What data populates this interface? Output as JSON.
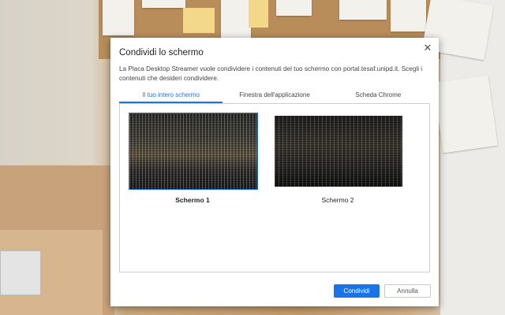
{
  "dialog": {
    "title": "Condividi lo schermo",
    "description": "La Placa Desktop Streamer vuole condividere i contenuti del tuo schermo con portal.tesaf.unipd.it. Scegli i contenuti che desideri condividere.",
    "close_icon": "close-icon"
  },
  "tabs": [
    {
      "label": "Il tuo intero schermo",
      "active": true
    },
    {
      "label": "Finestra dell'applicazione",
      "active": false
    },
    {
      "label": "Scheda Chrome",
      "active": false
    }
  ],
  "screens": [
    {
      "label": "Schermo 1",
      "selected": true
    },
    {
      "label": "Schermo 2",
      "selected": false
    }
  ],
  "buttons": {
    "share_label": "Condividi",
    "cancel_label": "Annulla"
  },
  "colors": {
    "accent": "#1a73e8"
  }
}
